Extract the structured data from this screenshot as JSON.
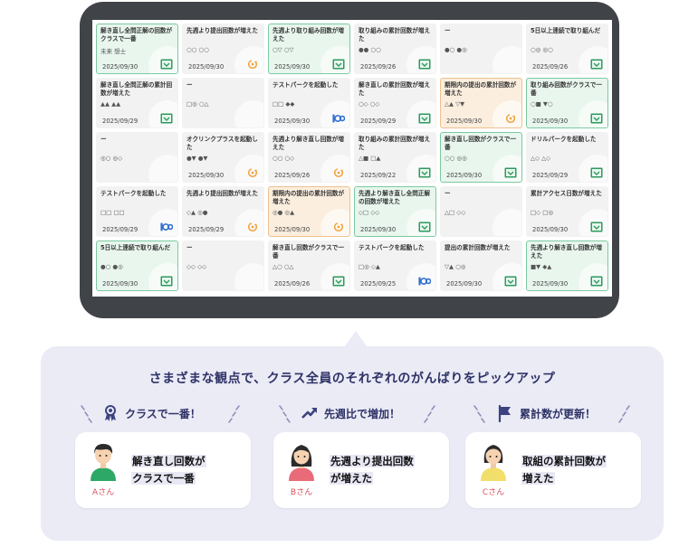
{
  "cards": [
    {
      "title": "解き直し全問正解の回数がクラスで一番",
      "names": "未来 想士",
      "date": "2025/09/30",
      "style": "green",
      "badge": "check"
    },
    {
      "title": "先週より提出回数が増えた",
      "names": "○○ ○○",
      "date": "2025/09/30",
      "style": "plain",
      "badge": "cycle"
    },
    {
      "title": "先週より取り組み回数が増えた",
      "names": "○▽ ○▽",
      "date": "2025/09/30",
      "style": "green",
      "badge": "check"
    },
    {
      "title": "取り組みの累計回数が増えた",
      "names": "●● ○○",
      "date": "2025/09/26",
      "style": "plain",
      "badge": "check"
    },
    {
      "title": "ー",
      "names": "●○ ●◎",
      "date": "",
      "style": "plain",
      "badge": ""
    },
    {
      "title": "5日以上連続で取り組んだ",
      "names": "○◎ ◎○",
      "date": "2025/09/26",
      "style": "plain",
      "badge": "check"
    },
    {
      "title": "解き直し全問正解の累計回数が増えた",
      "names": "▲▲ ▲▲",
      "date": "2025/09/29",
      "style": "plain",
      "badge": "check"
    },
    {
      "title": "ー",
      "names": "□◎ ○△",
      "date": "",
      "style": "plain",
      "badge": ""
    },
    {
      "title": "テストパークを起動した",
      "names": "□□ ◆◆",
      "date": "2025/09/30",
      "style": "plain",
      "badge": "logo"
    },
    {
      "title": "解き直しの累計回数が増えた",
      "names": "○◇ ○◇",
      "date": "2025/09/29",
      "style": "plain",
      "badge": "check"
    },
    {
      "title": "期限内の提出の累計回数が増えた",
      "names": "△▲ ▽▼",
      "date": "2025/09/30",
      "style": "orange",
      "badge": "cycle"
    },
    {
      "title": "取り組み回数がクラスで一番",
      "names": "○■ ▼○",
      "date": "2025/09/30",
      "style": "green",
      "badge": "check"
    },
    {
      "title": "ー",
      "names": "◎○ ◎◇",
      "date": "",
      "style": "plain",
      "badge": ""
    },
    {
      "title": "オクリンクプラスを起動した",
      "names": "●▼ ●▼",
      "date": "2025/09/30",
      "style": "plain",
      "badge": "cycle"
    },
    {
      "title": "先週より解き直し回数が増えた",
      "names": "○○ ○◇",
      "date": "2025/09/26",
      "style": "plain",
      "badge": "cycle"
    },
    {
      "title": "取り組みの累計回数が増えた",
      "names": "△■ □▲",
      "date": "2025/09/22",
      "style": "plain",
      "badge": "check"
    },
    {
      "title": "解き直し回数がクラスで一番",
      "names": "○○ ◎◎",
      "date": "2025/09/30",
      "style": "green",
      "badge": "check"
    },
    {
      "title": "ドリルパークを起動した",
      "names": "△◇ △◇",
      "date": "2025/09/29",
      "style": "plain",
      "badge": "check"
    },
    {
      "title": "テストパークを起動した",
      "names": "□□ □□",
      "date": "2025/09/29",
      "style": "plain",
      "badge": "logo"
    },
    {
      "title": "先週より提出回数が増えた",
      "names": "◇▲ ◎●",
      "date": "2025/09/29",
      "style": "plain",
      "badge": "cycle"
    },
    {
      "title": "期限内の提出の累計回数が増えた",
      "names": "◎● ◎▲",
      "date": "2025/09/30",
      "style": "orange",
      "badge": "cycle"
    },
    {
      "title": "先週より解き直し全問正解の回数が増えた",
      "names": "◇□ ◇◇",
      "date": "2025/09/30",
      "style": "green",
      "badge": "check"
    },
    {
      "title": "ー",
      "names": "△□ ◇◇",
      "date": "",
      "style": "plain",
      "badge": ""
    },
    {
      "title": "累計アクセス日数が増えた",
      "names": "□◇ □◎",
      "date": "2025/09/30",
      "style": "plain",
      "badge": "check"
    },
    {
      "title": "5日以上連続で取り組んだ",
      "names": "●○ ●◎",
      "date": "2025/09/30",
      "style": "green",
      "badge": "check"
    },
    {
      "title": "ー",
      "names": "◇◇ ◇◇",
      "date": "",
      "style": "plain",
      "badge": ""
    },
    {
      "title": "解き直し回数がクラスで一番",
      "names": "△○ ○△",
      "date": "2025/09/26",
      "style": "plain",
      "badge": "check"
    },
    {
      "title": "テストパークを起動した",
      "names": "□◎ ◇▲",
      "date": "2025/09/25",
      "style": "plain",
      "badge": "logo"
    },
    {
      "title": "提出の累計回数が増えた",
      "names": "▽▲ ○◎",
      "date": "2025/09/30",
      "style": "plain",
      "badge": "check"
    },
    {
      "title": "先週より解き直し回数が増えた",
      "names": "■▼ ◆▲",
      "date": "2025/09/30",
      "style": "green",
      "badge": "check"
    }
  ],
  "panel": {
    "headline": "さまざまな観点で、クラス全員のそれぞれのがんばりをピックアップ",
    "categories": [
      {
        "label": "クラスで一番！"
      },
      {
        "label": "先週比で増加！"
      },
      {
        "label": "累計数が更新！"
      }
    ],
    "people": [
      {
        "name": "Aさん",
        "line1": "解き直し回数が",
        "line2": "クラスで一番"
      },
      {
        "name": "Bさん",
        "line1": "先週より提出回数",
        "line2": "が増えた"
      },
      {
        "name": "Cさん",
        "line1": "取組の累計回数が",
        "line2": "増えた"
      }
    ]
  },
  "colors": {
    "accent_green": "#2d9a5e",
    "accent_orange": "#f0a23a",
    "navy": "#2e3266",
    "person_label": "#d9535f"
  }
}
